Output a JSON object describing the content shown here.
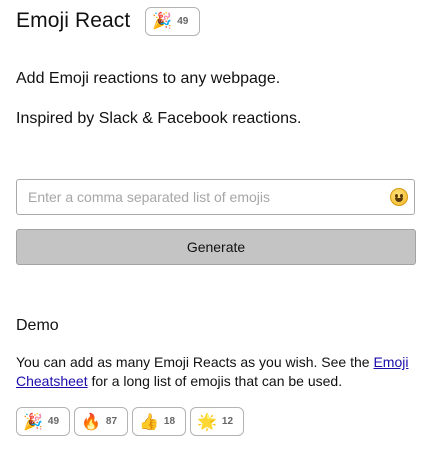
{
  "header": {
    "title": "Emoji React",
    "react": {
      "emoji": "🎉",
      "count": "49"
    }
  },
  "intro": {
    "line1": "Add Emoji reactions to any webpage.",
    "line2": "Inspired by Slack & Facebook reactions."
  },
  "form": {
    "input_placeholder": "Enter a comma separated list of emojis",
    "input_value": "",
    "picker_icon": "smiley-icon",
    "generate_label": "Generate"
  },
  "demo": {
    "title": "Demo",
    "text_before": "You can add as many Emoji Reacts as you wish. See the ",
    "link_text": "Emoji Cheatsheet",
    "text_after": " for a long list of emojis that can be used.",
    "reacts": [
      {
        "emoji": "🎉",
        "count": "49"
      },
      {
        "emoji": "🔥",
        "count": "87"
      },
      {
        "emoji": "👍",
        "count": "18"
      },
      {
        "emoji": "🌟",
        "count": "12"
      }
    ]
  },
  "colors": {
    "button_bg": "#c4c4c4",
    "link": "#1a0dab",
    "chip_border": "#b3b3b3",
    "count_text": "#666666"
  }
}
